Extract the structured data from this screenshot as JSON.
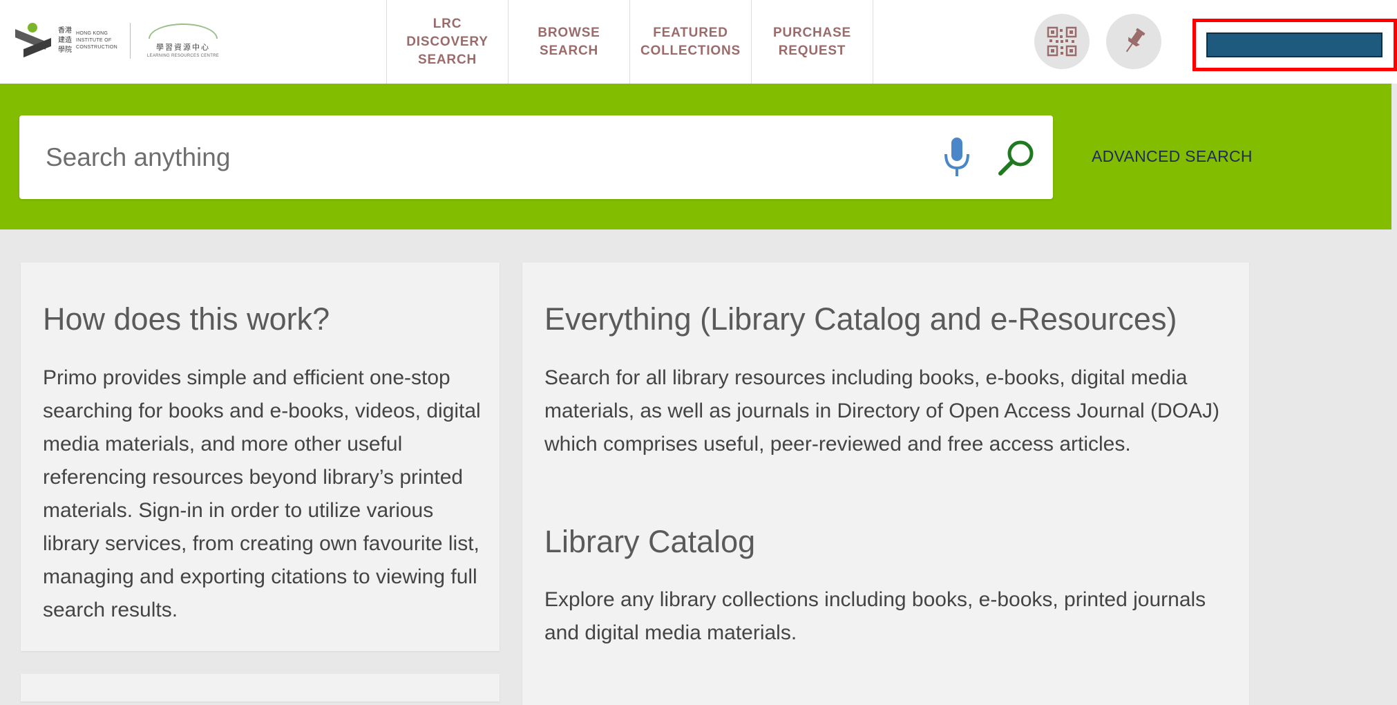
{
  "header": {
    "logo": {
      "institute_cn": "香港 建造 學院",
      "institute_en": "HONG KONG INSTITUTE OF CONSTRUCTION",
      "lrc_cn": "學習資源中心",
      "lrc_en": "LEARNING RESOURCES CENTRE"
    },
    "nav": [
      {
        "label": "LRC\nDISCOVERY\nSEARCH"
      },
      {
        "label": "BROWSE\nSEARCH"
      },
      {
        "label": "FEATURED\nCOLLECTIONS"
      },
      {
        "label": "PURCHASE\nREQUEST"
      }
    ],
    "icons": {
      "qr": "qr-code-icon",
      "pin": "pin-icon"
    }
  },
  "search": {
    "placeholder": "Search anything",
    "value": "",
    "advanced_label": "ADVANCED SEARCH"
  },
  "cards": {
    "how": {
      "title": "How does this work?",
      "body": "Primo provides simple and efficient one-stop searching for books and e-books, videos, digital media materials, and more other useful referencing resources beyond library’s printed materials. Sign-in in order to utilize various library services, from creating own favourite list, managing and exporting citations to viewing full search results."
    },
    "everything": {
      "title": "Everything (Library Catalog and e-Resources)",
      "body": "Search for all library resources including books, e-books, digital media materials, as well as journals in Directory of Open Access Journal (DOAJ) which comprises useful, peer-reviewed and free access articles."
    },
    "catalog": {
      "title": "Library Catalog",
      "body": "Explore any library collections including books, e-books, printed journals and digital media materials."
    }
  },
  "colors": {
    "brand_green": "#83bd00",
    "nav_text": "#9b6a6a",
    "advanced_text": "#1f2b59",
    "highlight_red": "#ff0000",
    "signin_blue": "#1e5a7e"
  }
}
